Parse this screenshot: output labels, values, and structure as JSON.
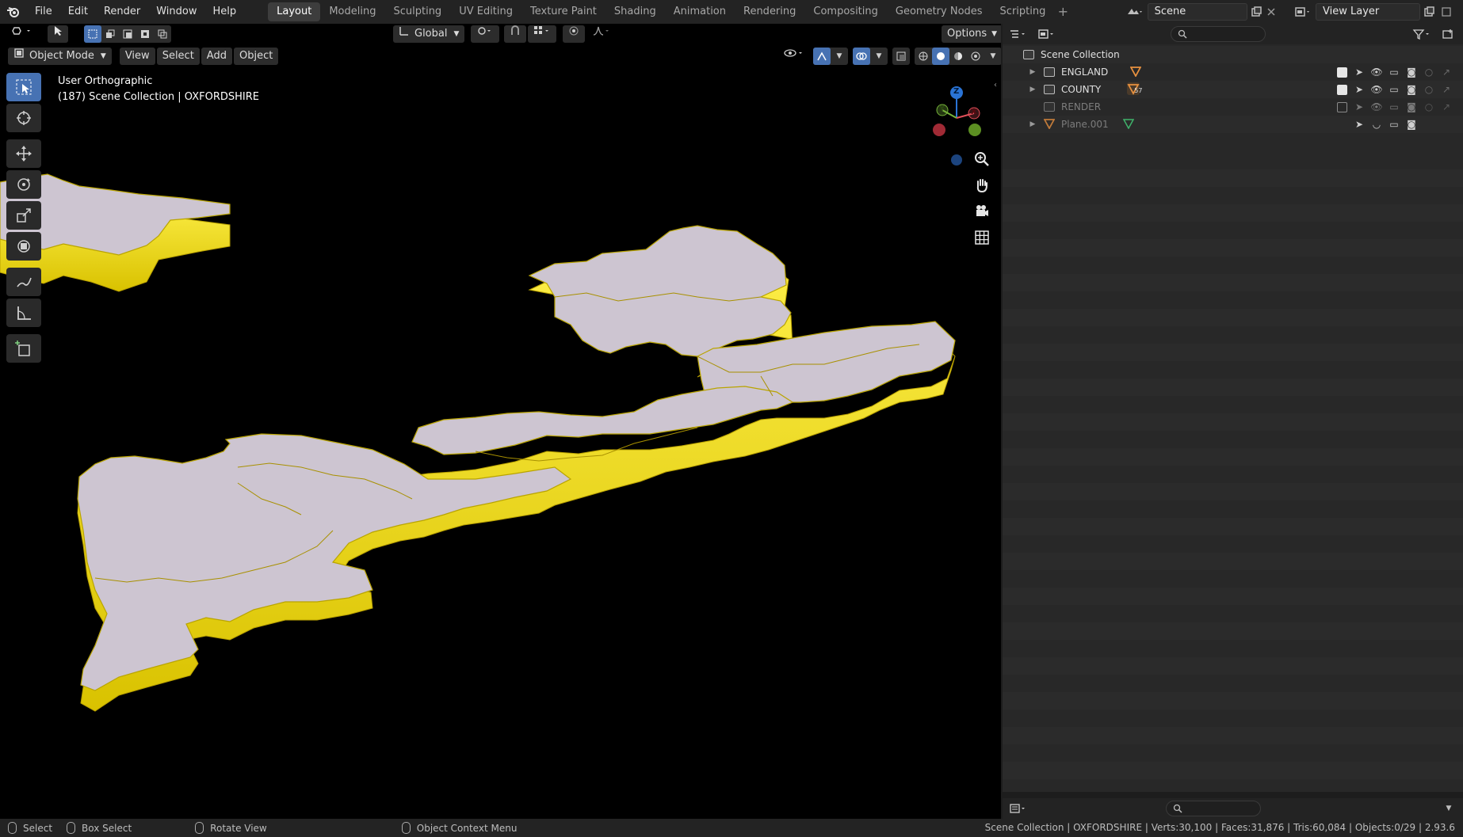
{
  "menu": {
    "items": [
      "File",
      "Edit",
      "Render",
      "Window",
      "Help"
    ]
  },
  "workspaces": {
    "tabs": [
      "Layout",
      "Modeling",
      "Sculpting",
      "UV Editing",
      "Texture Paint",
      "Shading",
      "Animation",
      "Rendering",
      "Compositing",
      "Geometry Nodes",
      "Scripting"
    ],
    "active": "Layout",
    "add_label": "+"
  },
  "scene": {
    "name": "Scene"
  },
  "view_layer": {
    "name": "View Layer"
  },
  "viewport": {
    "orientation_label": "Global",
    "options_label": "Options",
    "mode_label": "Object Mode",
    "menus": [
      "View",
      "Select",
      "Add",
      "Object"
    ],
    "overlay_line1": "User Orthographic",
    "overlay_line2": "(187) Scene Collection | OXFORDSHIRE",
    "gizmo_axes": {
      "x": "X",
      "y": "Y",
      "z": "Z"
    },
    "colors": {
      "extrusion": "#f2de12",
      "top_face": "#cdc5d1",
      "background": "#000000",
      "accent": "#4772b3"
    }
  },
  "outliner": {
    "root": "Scene Collection",
    "rows": [
      {
        "name": "ENGLAND",
        "type": "collection",
        "checked": true,
        "dim": false
      },
      {
        "name": "COUNTY",
        "type": "collection",
        "checked": true,
        "dim": false,
        "badge": "57"
      },
      {
        "name": "RENDER",
        "type": "collection",
        "checked": false,
        "dim": true
      },
      {
        "name": "Plane.001",
        "type": "object",
        "dim": true
      }
    ]
  },
  "statusbar": {
    "select": "Select",
    "box_select": "Box Select",
    "rotate_view": "Rotate View",
    "context_menu": "Object Context Menu",
    "stats": "Scene Collection | OXFORDSHIRE | Verts:30,100 | Faces:31,876 | Tris:60,084 | Objects:0/29 | 2.93.6"
  }
}
